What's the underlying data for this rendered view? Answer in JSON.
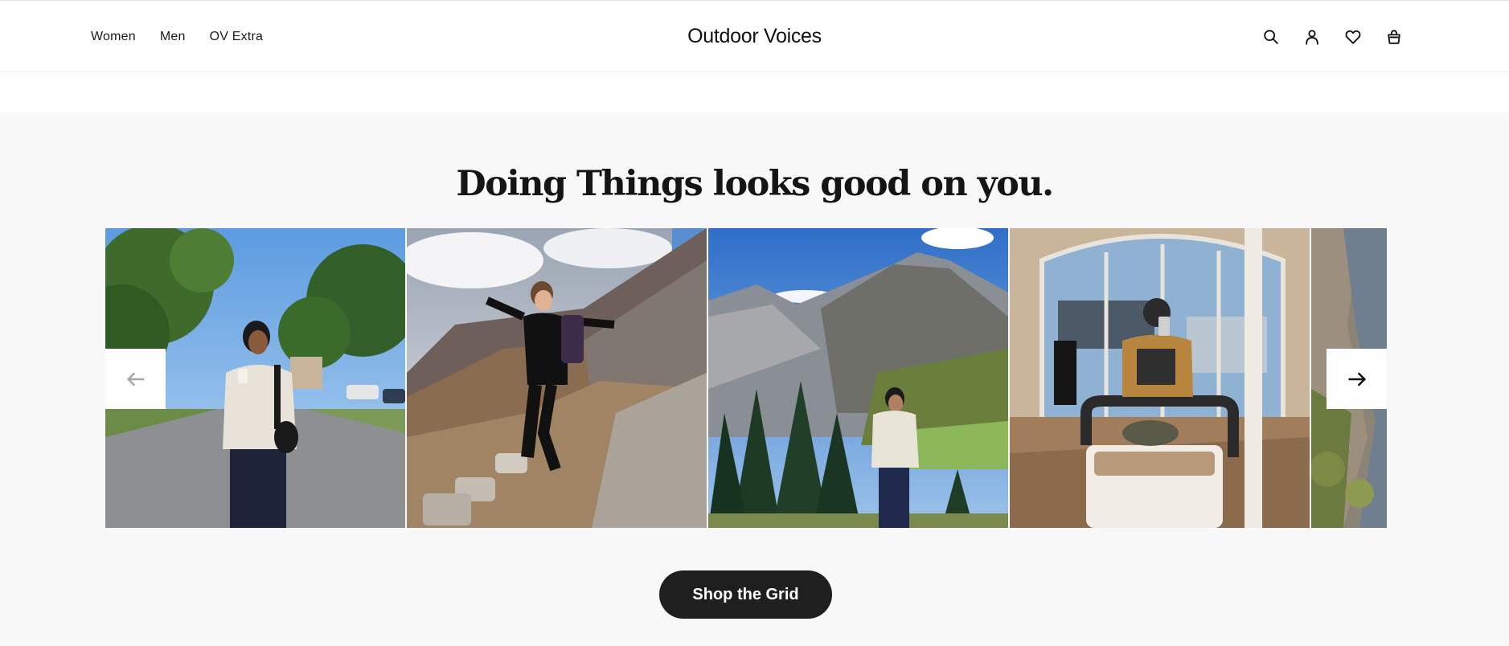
{
  "header": {
    "nav_left": [
      "Women",
      "Men",
      "OV Extra"
    ],
    "logo": "Outdoor Voices",
    "icons": [
      "search-icon",
      "account-icon",
      "wishlist-icon",
      "cart-icon"
    ]
  },
  "ugc": {
    "title": "Doing Things looks good on you.",
    "slides": [
      {
        "name": "photo-woman-street-coffee"
      },
      {
        "name": "photo-woman-jumping-trail"
      },
      {
        "name": "photo-man-mountain-view"
      },
      {
        "name": "photo-woman-pilates-studio"
      },
      {
        "name": "photo-rocky-cliff-partial"
      }
    ],
    "prev_icon": "arrow-left-icon",
    "next_icon": "arrow-right-icon",
    "cta_label": "Shop the Grid"
  },
  "colors": {
    "section_bg": "#f8f8f8",
    "cta_bg": "#1f1f1f",
    "text": "#111111"
  }
}
